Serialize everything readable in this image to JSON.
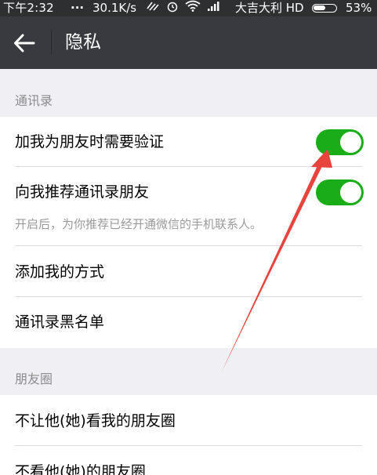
{
  "status_bar": {
    "time": "下午2:32",
    "dots": "...",
    "net_speed": "30.1K/s",
    "carrier": "大吉大利 HD",
    "battery": "53%"
  },
  "header": {
    "title": "隐私"
  },
  "sections": {
    "contacts": {
      "title": "通讯录",
      "rows": [
        {
          "label": "加我为朋友时需要验证",
          "toggle": "on"
        },
        {
          "label": "向我推荐通讯录朋友",
          "toggle": "on",
          "subtext": "开启后，为你推荐已经开通微信的手机联系人。"
        },
        {
          "label": "添加我的方式"
        },
        {
          "label": "通讯录黑名单"
        }
      ]
    },
    "moments": {
      "title": "朋友圈",
      "rows": [
        {
          "label": "不让他(她)看我的朋友圈"
        },
        {
          "label": "不看他(她)的朋友圈"
        }
      ]
    }
  },
  "colors": {
    "status_bar_bg": "#2e2f31",
    "title_bar_bg": "#393a3f",
    "toggle_on": "#1aad19",
    "section_bg": "#efeff4",
    "annotation_arrow": "#e8433d"
  }
}
